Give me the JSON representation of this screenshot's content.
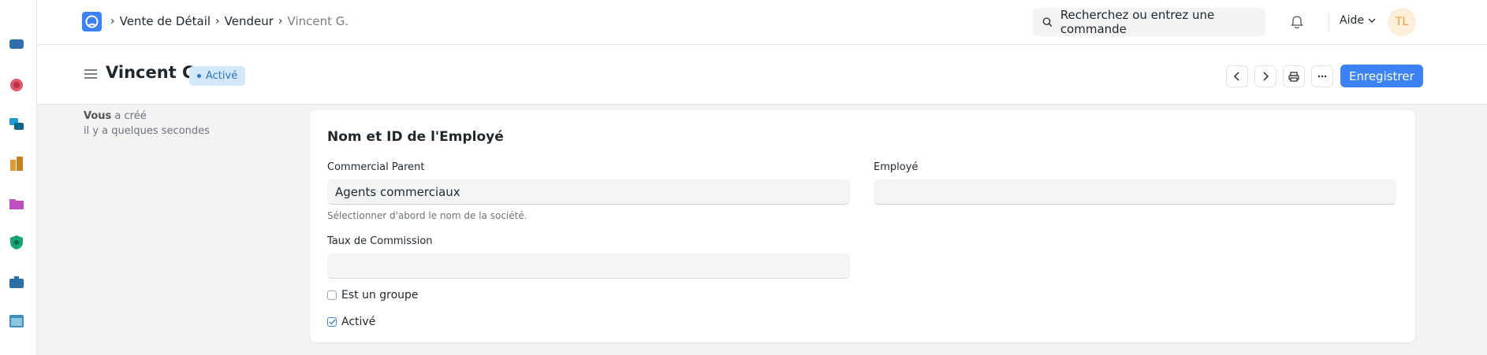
{
  "breadcrumb": {
    "items": [
      "Vente de Détail",
      "Vendeur",
      "Vincent G."
    ]
  },
  "search": {
    "placeholder": "Recherchez ou entrez une commande"
  },
  "help": {
    "label": "Aide"
  },
  "user": {
    "initials": "TL"
  },
  "header": {
    "title": "Vincent G.",
    "status": "Activé",
    "save_label": "Enregistrer"
  },
  "activity": {
    "actor": "Vous",
    "action": " a créé",
    "time": "il y a quelques secondes"
  },
  "form": {
    "section_title": "Nom et ID de l'Employé",
    "commercial_parent": {
      "label": "Commercial Parent",
      "value": "Agents commerciaux",
      "help": "Sélectionner d'abord le nom de la société."
    },
    "employee": {
      "label": "Employé",
      "value": ""
    },
    "commission_rate": {
      "label": "Taux de Commission",
      "value": ""
    },
    "is_group": {
      "label": "Est un groupe",
      "checked": false
    },
    "enabled": {
      "label": "Activé",
      "checked": true
    }
  },
  "colors": {
    "primary": "#3b82f6",
    "badge_bg": "#d2e8fb",
    "badge_text": "#2a74c2",
    "avatar_bg": "#fdeed9",
    "avatar_text": "#e9a03b"
  }
}
